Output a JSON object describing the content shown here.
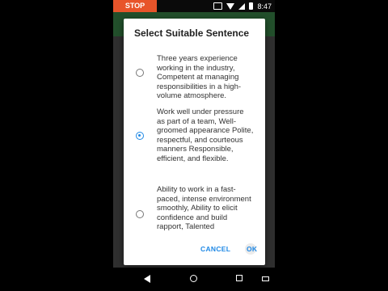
{
  "status_bar": {
    "stop_label": "STOP",
    "time": "8:47"
  },
  "dialog": {
    "title": "Select Suitable Sentence",
    "options": [
      {
        "text": "Three years experience working in the industry, Competent at managing responsibilities in a high-volume atmosphere.",
        "selected": false
      },
      {
        "text": "Work well under pressure as part of a team, Well-groomed appearance Polite, respectful, and courteous manners Responsible, efficient, and flexible.",
        "selected": true
      },
      {
        "text": "Ability to work in a fast-paced, intense environment smoothly, Ability to elicit confidence and build rapport, Talented",
        "selected": false
      }
    ],
    "cancel_label": "CANCEL",
    "ok_label": "OK"
  },
  "colors": {
    "accent": "#1e88e5",
    "stop": "#e8542a",
    "appbar": "#2e6a3a"
  }
}
